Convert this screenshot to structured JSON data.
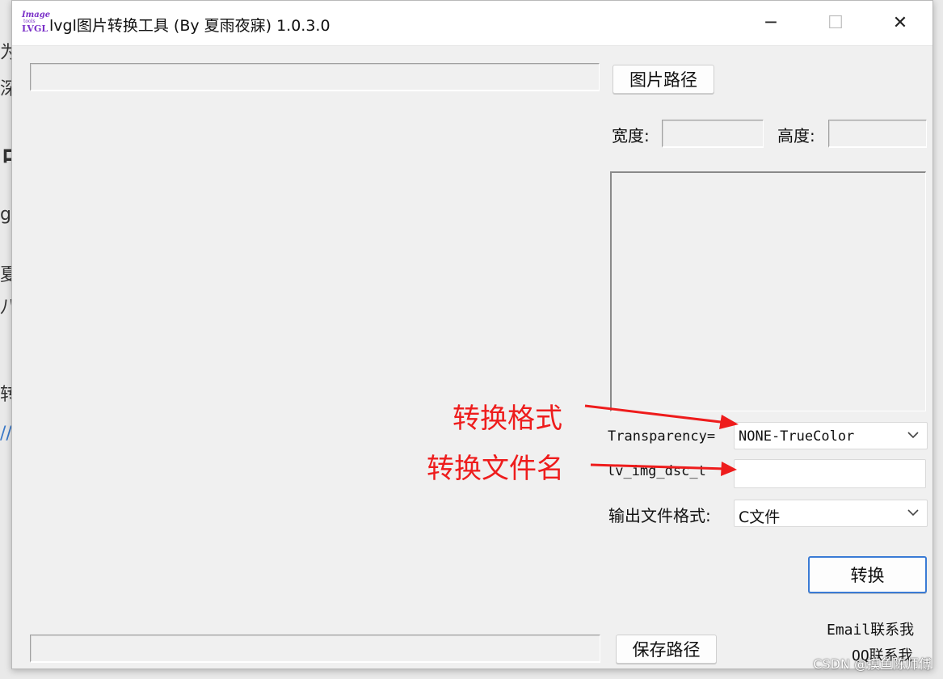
{
  "window": {
    "title": "lvgl图片转换工具 (By 夏雨夜寐) 1.0.3.0",
    "icon_line1": "Image",
    "icon_line2": "tools",
    "icon_line3": "LVGL",
    "minimize_glyph": "─",
    "maximize_glyph": "☐",
    "close_glyph": "✕"
  },
  "top": {
    "image_path_button": "图片路径",
    "width_label": "宽度:",
    "height_label": "高度:"
  },
  "options": {
    "transparency_label": "Transparency=",
    "transparency_value": "NONE-TrueColor",
    "output_name_label": "lv_img_dsc_t",
    "output_name_value": "",
    "format_label": "输出文件格式:",
    "format_value": "C文件",
    "convert_button": "转换"
  },
  "contact": {
    "email": "Email联系我",
    "qq": "QQ联系我"
  },
  "bottom": {
    "save_path_button": "保存路径"
  },
  "annotations": {
    "format_note": "转换格式",
    "filename_note": "转换文件名",
    "color": "#ee1c1c"
  },
  "background_fragments": [
    "为",
    "深",
    "占",
    "g",
    "夏",
    "八",
    "转",
    "//"
  ],
  "watermark": "CSDN @摸鱼陈师傅"
}
